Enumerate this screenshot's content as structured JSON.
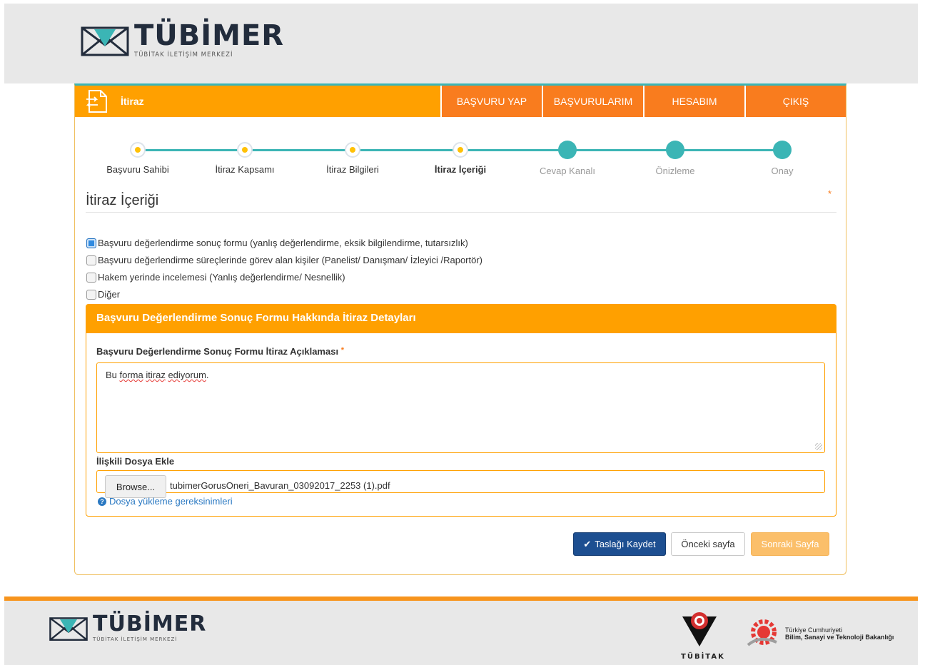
{
  "brand": {
    "name": "TÜBİMER",
    "subtitle": "TÜBİTAK İLETİŞİM MERKEZİ"
  },
  "titlebar": {
    "title": "İtiraz",
    "nav": [
      "BAŞVURU YAP",
      "BAŞVURULARIM",
      "HESABIM",
      "ÇIKIŞ"
    ]
  },
  "stepper": {
    "steps": [
      {
        "label": "Başvuru Sahibi",
        "state": "done"
      },
      {
        "label": "İtiraz Kapsamı",
        "state": "done"
      },
      {
        "label": "İtiraz Bilgileri",
        "state": "done"
      },
      {
        "label": "İtiraz İçeriği",
        "state": "active"
      },
      {
        "label": "Cevap Kanalı",
        "state": "todo"
      },
      {
        "label": "Önizleme",
        "state": "todo"
      },
      {
        "label": "Onay",
        "state": "todo"
      }
    ]
  },
  "section": {
    "title": "İtiraz İçeriği",
    "required_mark": "*"
  },
  "options": [
    {
      "label": "Başvuru değerlendirme sonuç formu (yanlış değerlendirme, eksik bilgilendirme, tutarsızlık)",
      "checked": true
    },
    {
      "label": "Başvuru değerlendirme süreçlerinde görev alan kişiler (Panelist/ Danışman/ İzleyici /Raportör)",
      "checked": false
    },
    {
      "label": "Hakem yerinde incelemesi (Yanlış değerlendirme/ Nesnellik)",
      "checked": false
    },
    {
      "label": "Diğer",
      "checked": false
    }
  ],
  "detail": {
    "heading": "Başvuru Değerlendirme Sonuç Formu Hakkında İtiraz Detayları",
    "explanation_label": "Başvuru Değerlendirme Sonuç Formu İtiraz Açıklaması",
    "explanation_required": "*",
    "explanation_value": {
      "part1": "Bu ",
      "part2": "forma",
      "part3": " ",
      "part4": "itiraz",
      "part5": " ",
      "part6": "ediyorum",
      "part7": "."
    },
    "file_label": "İlişkili Dosya Ekle",
    "browse_label": "Browse...",
    "file_name": "tubimerGorusOneri_Bavuran_03092017_2253 (1).pdf",
    "help_link": "Dosya yükleme gereksinimleri"
  },
  "buttons": {
    "save": "Taslağı Kaydet",
    "prev": "Önceki sayfa",
    "next": "Sonraki Sayfa"
  },
  "footer": {
    "tubitak": "TÜBİTAK",
    "ministry_line1": "Türkiye Cumhuriyeti",
    "ministry_line2": "Bilim, Sanayi ve Teknoloji Bakanlığı"
  },
  "colors": {
    "accent_orange": "#ffa000",
    "nav_orange": "#f97c1e",
    "teal": "#3bb5b5",
    "navy": "#1d4f91"
  }
}
